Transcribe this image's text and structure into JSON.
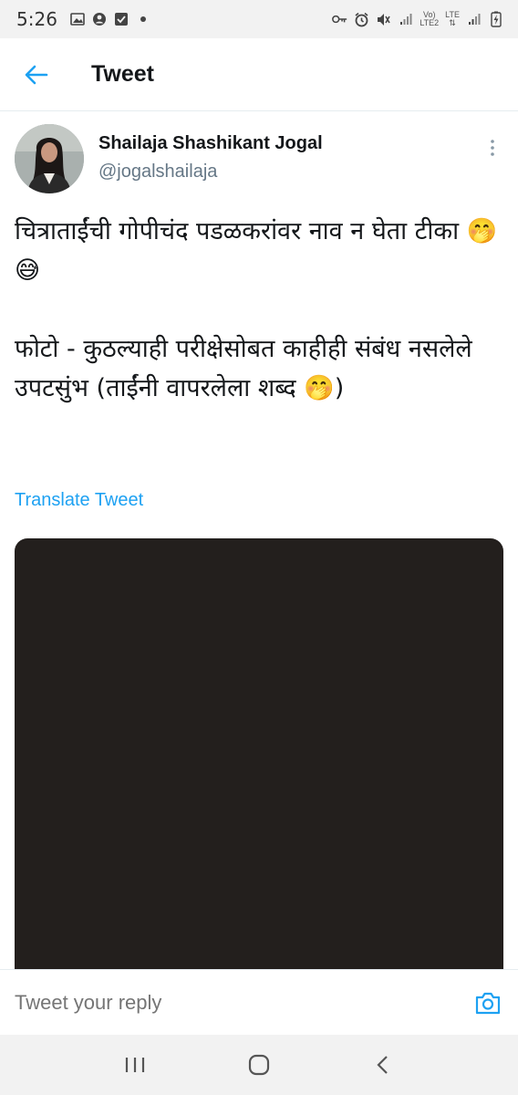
{
  "status_bar": {
    "time": "5:26",
    "volte_label": "Vo)",
    "lte2_label": "LTE2",
    "lte_label": "LTE"
  },
  "header": {
    "title": "Tweet"
  },
  "tweet": {
    "author_name": "Shailaja Shashikant Jogal",
    "author_handle": "@jogalshailaja",
    "text": "चित्राताईंची गोपीचंद पडळकरांवर नाव न घेता टीका 🤭😅\n\nफोटो - कुठल्याही परीक्षेसोबत काहीही संबंध नसलेले उपटसुंभ (ताईंनी वापरलेला शब्द 🤭)",
    "translate_label": "Translate Tweet"
  },
  "reply": {
    "placeholder": "Tweet your reply"
  },
  "colors": {
    "accent": "#1da1f2",
    "media_bg": "#231f1d"
  }
}
